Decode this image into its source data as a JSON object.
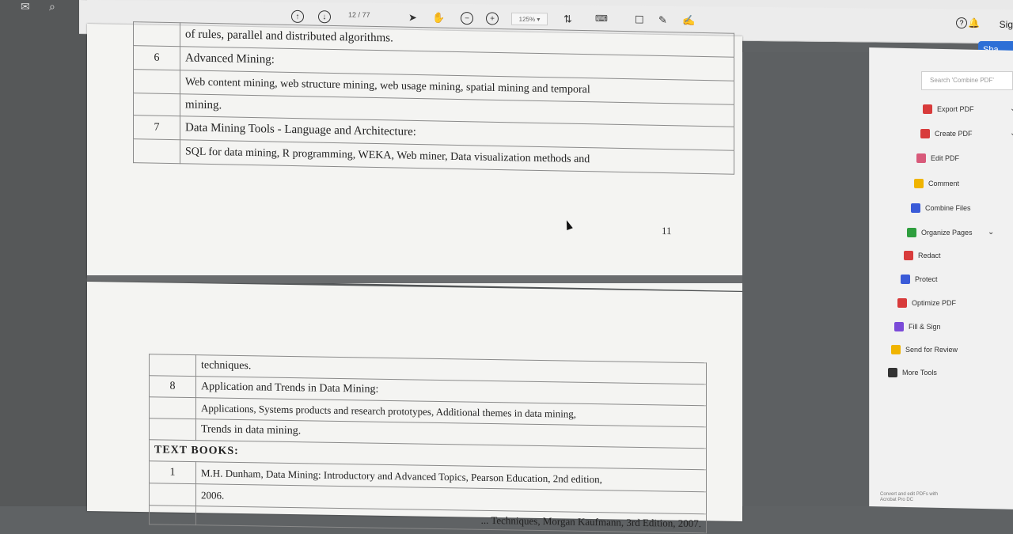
{
  "toolbar": {
    "page_current": "12",
    "page_sep": "/",
    "page_total": "77",
    "zoom": "125%"
  },
  "header_right": {
    "help": "?",
    "signin": "Sig",
    "share": "Sha"
  },
  "page1": {
    "rows": [
      {
        "num": "",
        "text": "of rules, parallel and distributed algorithms."
      },
      {
        "num": "6",
        "text": "Advanced Mining:"
      },
      {
        "num": "",
        "text": "Web content mining, web structure mining, web usage mining, spatial mining and temporal"
      },
      {
        "num": "",
        "text": "mining."
      },
      {
        "num": "7",
        "text": "Data Mining Tools - Language and Architecture:"
      },
      {
        "num": "",
        "text": "SQL for data mining, R programming, WEKA, Web miner, Data visualization methods and"
      }
    ],
    "page_number": "11"
  },
  "page2": {
    "rows": [
      {
        "num": "",
        "text": "techniques."
      },
      {
        "num": "8",
        "text": "Application and Trends in Data Mining:"
      },
      {
        "num": "",
        "text": "Applications, Systems products and research prototypes, Additional themes in data mining,"
      },
      {
        "num": "",
        "text": "Trends in data mining."
      }
    ],
    "heading": "TEXT BOOKS:",
    "books": [
      {
        "num": "1",
        "text": "M.H. Dunham, Data Mining: Introductory and Advanced Topics, Pearson Education, 2nd edition,"
      },
      {
        "num": "",
        "text": "2006."
      },
      {
        "num": "",
        "text": "... Techniques, Morgan Kaufmann, 3rd Edition, 2007."
      }
    ]
  },
  "right_panel": {
    "search_placeholder": "Search 'Combine PDF'",
    "tools": [
      {
        "label": "Export PDF",
        "icon": "export-pdf-icon",
        "color": "#d83b3b"
      },
      {
        "label": "Create PDF",
        "icon": "create-pdf-icon",
        "color": "#d83b3b"
      },
      {
        "label": "Edit PDF",
        "icon": "edit-pdf-icon",
        "color": "#d85a7a"
      },
      {
        "label": "Comment",
        "icon": "comment-icon",
        "color": "#f0b400"
      },
      {
        "label": "Combine Files",
        "icon": "combine-files-icon",
        "color": "#3a5bd8"
      },
      {
        "label": "Organize Pages",
        "icon": "organize-pages-icon",
        "color": "#2e9e3e"
      },
      {
        "label": "Redact",
        "icon": "redact-icon",
        "color": "#d83b3b"
      },
      {
        "label": "Protect",
        "icon": "protect-icon",
        "color": "#3a5bd8"
      },
      {
        "label": "Optimize PDF",
        "icon": "optimize-pdf-icon",
        "color": "#d83b3b"
      },
      {
        "label": "Fill & Sign",
        "icon": "fill-sign-icon",
        "color": "#7b4bd8"
      },
      {
        "label": "Send for Review",
        "icon": "send-review-icon",
        "color": "#f0b400"
      },
      {
        "label": "More Tools",
        "icon": "more-tools-icon",
        "color": "#333333"
      }
    ],
    "footer": "Convert and edit PDFs with Acrobat Pro DC"
  }
}
